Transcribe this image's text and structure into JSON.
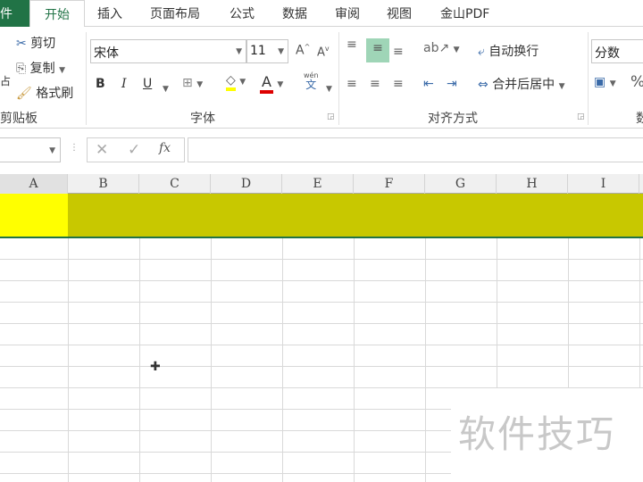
{
  "tabs": {
    "file": "件",
    "home": "开始",
    "insert": "插入",
    "layout": "页面布局",
    "formulas": "公式",
    "data": "数据",
    "review": "审阅",
    "view": "视图",
    "pdf": "金山PDF"
  },
  "clipboard": {
    "paste_fragment": "占",
    "cut": "剪切",
    "copy": "复制",
    "format_painter": "格式刷",
    "group": "剪贴板"
  },
  "font": {
    "name": "宋体",
    "size": "11",
    "bold": "B",
    "italic": "I",
    "underline": "U",
    "font_color": "A",
    "phonetic": "wén",
    "phonetic_char": "文",
    "group": "字体"
  },
  "alignment": {
    "wrap": "自动换行",
    "merge": "合并后居中",
    "group": "对齐方式"
  },
  "number": {
    "format": "分数",
    "percent": "%",
    "group_fragment": "数"
  },
  "formula_bar": {
    "cancel": "✕",
    "enter": "✓",
    "fx": "fx",
    "value": ""
  },
  "columns": [
    "A",
    "B",
    "C",
    "D",
    "E",
    "F",
    "G",
    "H",
    "I"
  ],
  "colors": {
    "accent": "#217346",
    "cell_a1": "#ffff00",
    "cell_row1": "#c8c800"
  },
  "watermark": "软件技巧"
}
